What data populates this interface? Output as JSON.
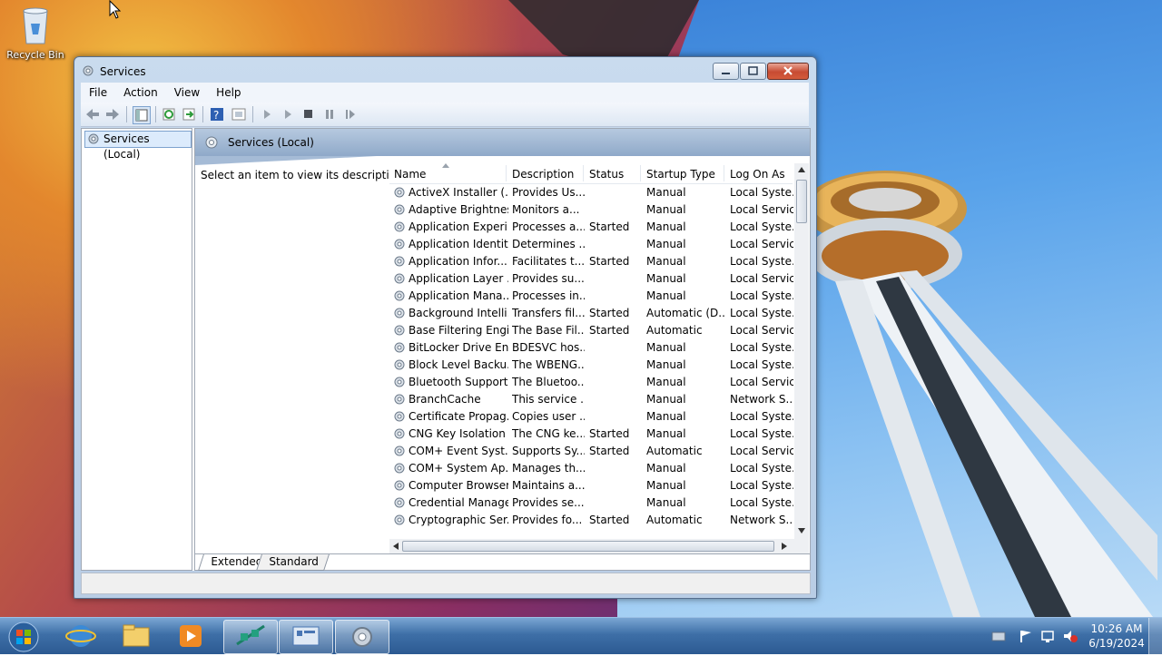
{
  "desktop": {
    "recycle_bin_label": "Recycle Bin"
  },
  "window": {
    "title": "Services",
    "menu": [
      "File",
      "Action",
      "View",
      "Help"
    ],
    "tree_node": "Services (Local)",
    "pane_title": "Services (Local)",
    "description_prompt": "Select an item to view its description.",
    "columns": [
      "Name",
      "Description",
      "Status",
      "Startup Type",
      "Log On As"
    ],
    "rows": [
      [
        "ActiveX Installer (...",
        "Provides Us...",
        "",
        "Manual",
        "Local Syste..."
      ],
      [
        "Adaptive Brightness",
        "Monitors a...",
        "",
        "Manual",
        "Local Service"
      ],
      [
        "Application Experi...",
        "Processes a...",
        "Started",
        "Manual",
        "Local Syste..."
      ],
      [
        "Application Identity",
        "Determines ...",
        "",
        "Manual",
        "Local Service"
      ],
      [
        "Application Infor...",
        "Facilitates t...",
        "Started",
        "Manual",
        "Local Syste..."
      ],
      [
        "Application Layer ...",
        "Provides su...",
        "",
        "Manual",
        "Local Service"
      ],
      [
        "Application Mana...",
        "Processes in...",
        "",
        "Manual",
        "Local Syste..."
      ],
      [
        "Background Intelli...",
        "Transfers fil...",
        "Started",
        "Automatic (D...",
        "Local Syste..."
      ],
      [
        "Base Filtering Engi...",
        "The Base Fil...",
        "Started",
        "Automatic",
        "Local Service"
      ],
      [
        "BitLocker Drive En...",
        "BDESVC hos...",
        "",
        "Manual",
        "Local Syste..."
      ],
      [
        "Block Level Backu...",
        "The WBENG...",
        "",
        "Manual",
        "Local Syste..."
      ],
      [
        "Bluetooth Support...",
        "The Bluetoo...",
        "",
        "Manual",
        "Local Service"
      ],
      [
        "BranchCache",
        "This service ...",
        "",
        "Manual",
        "Network S..."
      ],
      [
        "Certificate Propag...",
        "Copies user ...",
        "",
        "Manual",
        "Local Syste..."
      ],
      [
        "CNG Key Isolation",
        "The CNG ke...",
        "Started",
        "Manual",
        "Local Syste..."
      ],
      [
        "COM+ Event Syst...",
        "Supports Sy...",
        "Started",
        "Automatic",
        "Local Service"
      ],
      [
        "COM+ System Ap...",
        "Manages th...",
        "",
        "Manual",
        "Local Syste..."
      ],
      [
        "Computer Browser",
        "Maintains a...",
        "",
        "Manual",
        "Local Syste..."
      ],
      [
        "Credential Manager",
        "Provides se...",
        "",
        "Manual",
        "Local Syste..."
      ],
      [
        "Cryptographic Ser...",
        "Provides fo...",
        "Started",
        "Automatic",
        "Network S..."
      ]
    ],
    "tabs": [
      "Extended",
      "Standard"
    ]
  },
  "taskbar": {
    "time": "10:26 AM",
    "date": "6/19/2024"
  },
  "colors": {
    "title_bar": "#c9dbee",
    "close_button": "#c74b32",
    "taskbar": "#3e6fa7",
    "selection": "#dcebfc"
  }
}
